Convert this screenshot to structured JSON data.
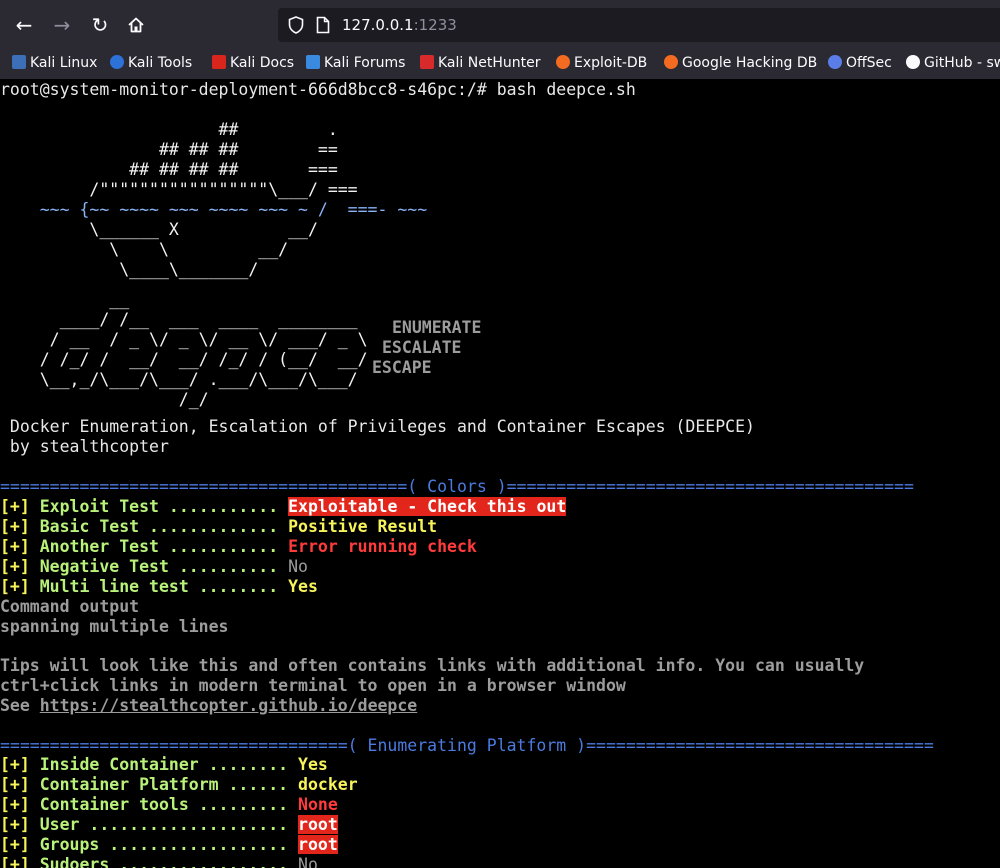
{
  "browser": {
    "url_host": "127.0.0.1",
    "url_port": ":1233",
    "bookmarks": [
      "Kali Linux",
      "Kali Tools",
      "Kali Docs",
      "Kali Forums",
      "Kali NetHunter",
      "Exploit-DB",
      "Google Hacking DB",
      "OffSec",
      "GitHub - sw"
    ]
  },
  "terminal": {
    "prompt": "root@system-monitor-deployment-666d8bcc8-s46pc:/# bash deepce.sh",
    "ascii_art": [
      "                      ##         .",
      "                ## ## ##        ==",
      "             ## ## ## ##       ===",
      "         /\"\"\"\"\"\"\"\"\"\"\"\"\"\"\"\"\"\\___/ ===",
      "    ~~~ {~~ ~~~~ ~~~ ~~~~ ~~~ ~ /  ===- ~~~",
      "         \\______ X           __/",
      "           \\    \\         __/",
      "            \\____\\_______/",
      "",
      "           __",
      "      ____/ /__  ___  ____  ________",
      "     / __  / _ \\/ _ \\/ __ \\/ ___/ _ \\",
      "    / /_/ /  __/  __/ /_/ / (__/  __/",
      "    \\__,_/\\___/\\___/ .___/\\___/\\___/",
      "                  /_/"
    ],
    "tagline": [
      "ENUMERATE",
      "ESCALATE",
      "ESCAPE"
    ],
    "title": " Docker Enumeration, Escalation of Privileges and Container Escapes (DEEPCE)",
    "byline": " by stealthcopter",
    "colors_header": "=========================================( Colors )=========================================",
    "colors_tests": [
      {
        "prefix": "[+] ",
        "label": "Exploit Test ........... ",
        "result": "Exploitable - Check this out"
      },
      {
        "prefix": "[+] ",
        "label": "Basic Test ............. ",
        "result": "Positive Result"
      },
      {
        "prefix": "[+] ",
        "label": "Another Test ........... ",
        "result": "Error running check"
      },
      {
        "prefix": "[+] ",
        "label": "Negative Test .......... ",
        "result": "No"
      },
      {
        "prefix": "[+] ",
        "label": "Multi line test ........ ",
        "result": "Yes"
      }
    ],
    "command_output": [
      "Command output",
      "spanning multiple lines"
    ],
    "tips": [
      "Tips will look like this and often contains links with additional info. You can usually",
      "ctrl+click links in modern terminal to open in a browser window"
    ],
    "tips_see": "See ",
    "tips_link": "https://stealthcopter.github.io/deepce",
    "platform_header": "===================================( Enumerating Platform )===================================",
    "platform_tests": [
      {
        "prefix": "[+] ",
        "label": "Inside Container ........ ",
        "result": "Yes"
      },
      {
        "prefix": "[+] ",
        "label": "Container Platform ...... ",
        "result": "docker"
      },
      {
        "prefix": "[+] ",
        "label": "Container tools ......... ",
        "result": "None"
      },
      {
        "prefix": "[+] ",
        "label": "User .................... ",
        "result": "root"
      },
      {
        "prefix": "[+] ",
        "label": "Groups .................. ",
        "result": "root"
      },
      {
        "prefix": "[+] ",
        "label": "Sudoers ................. ",
        "result": "No"
      }
    ]
  }
}
